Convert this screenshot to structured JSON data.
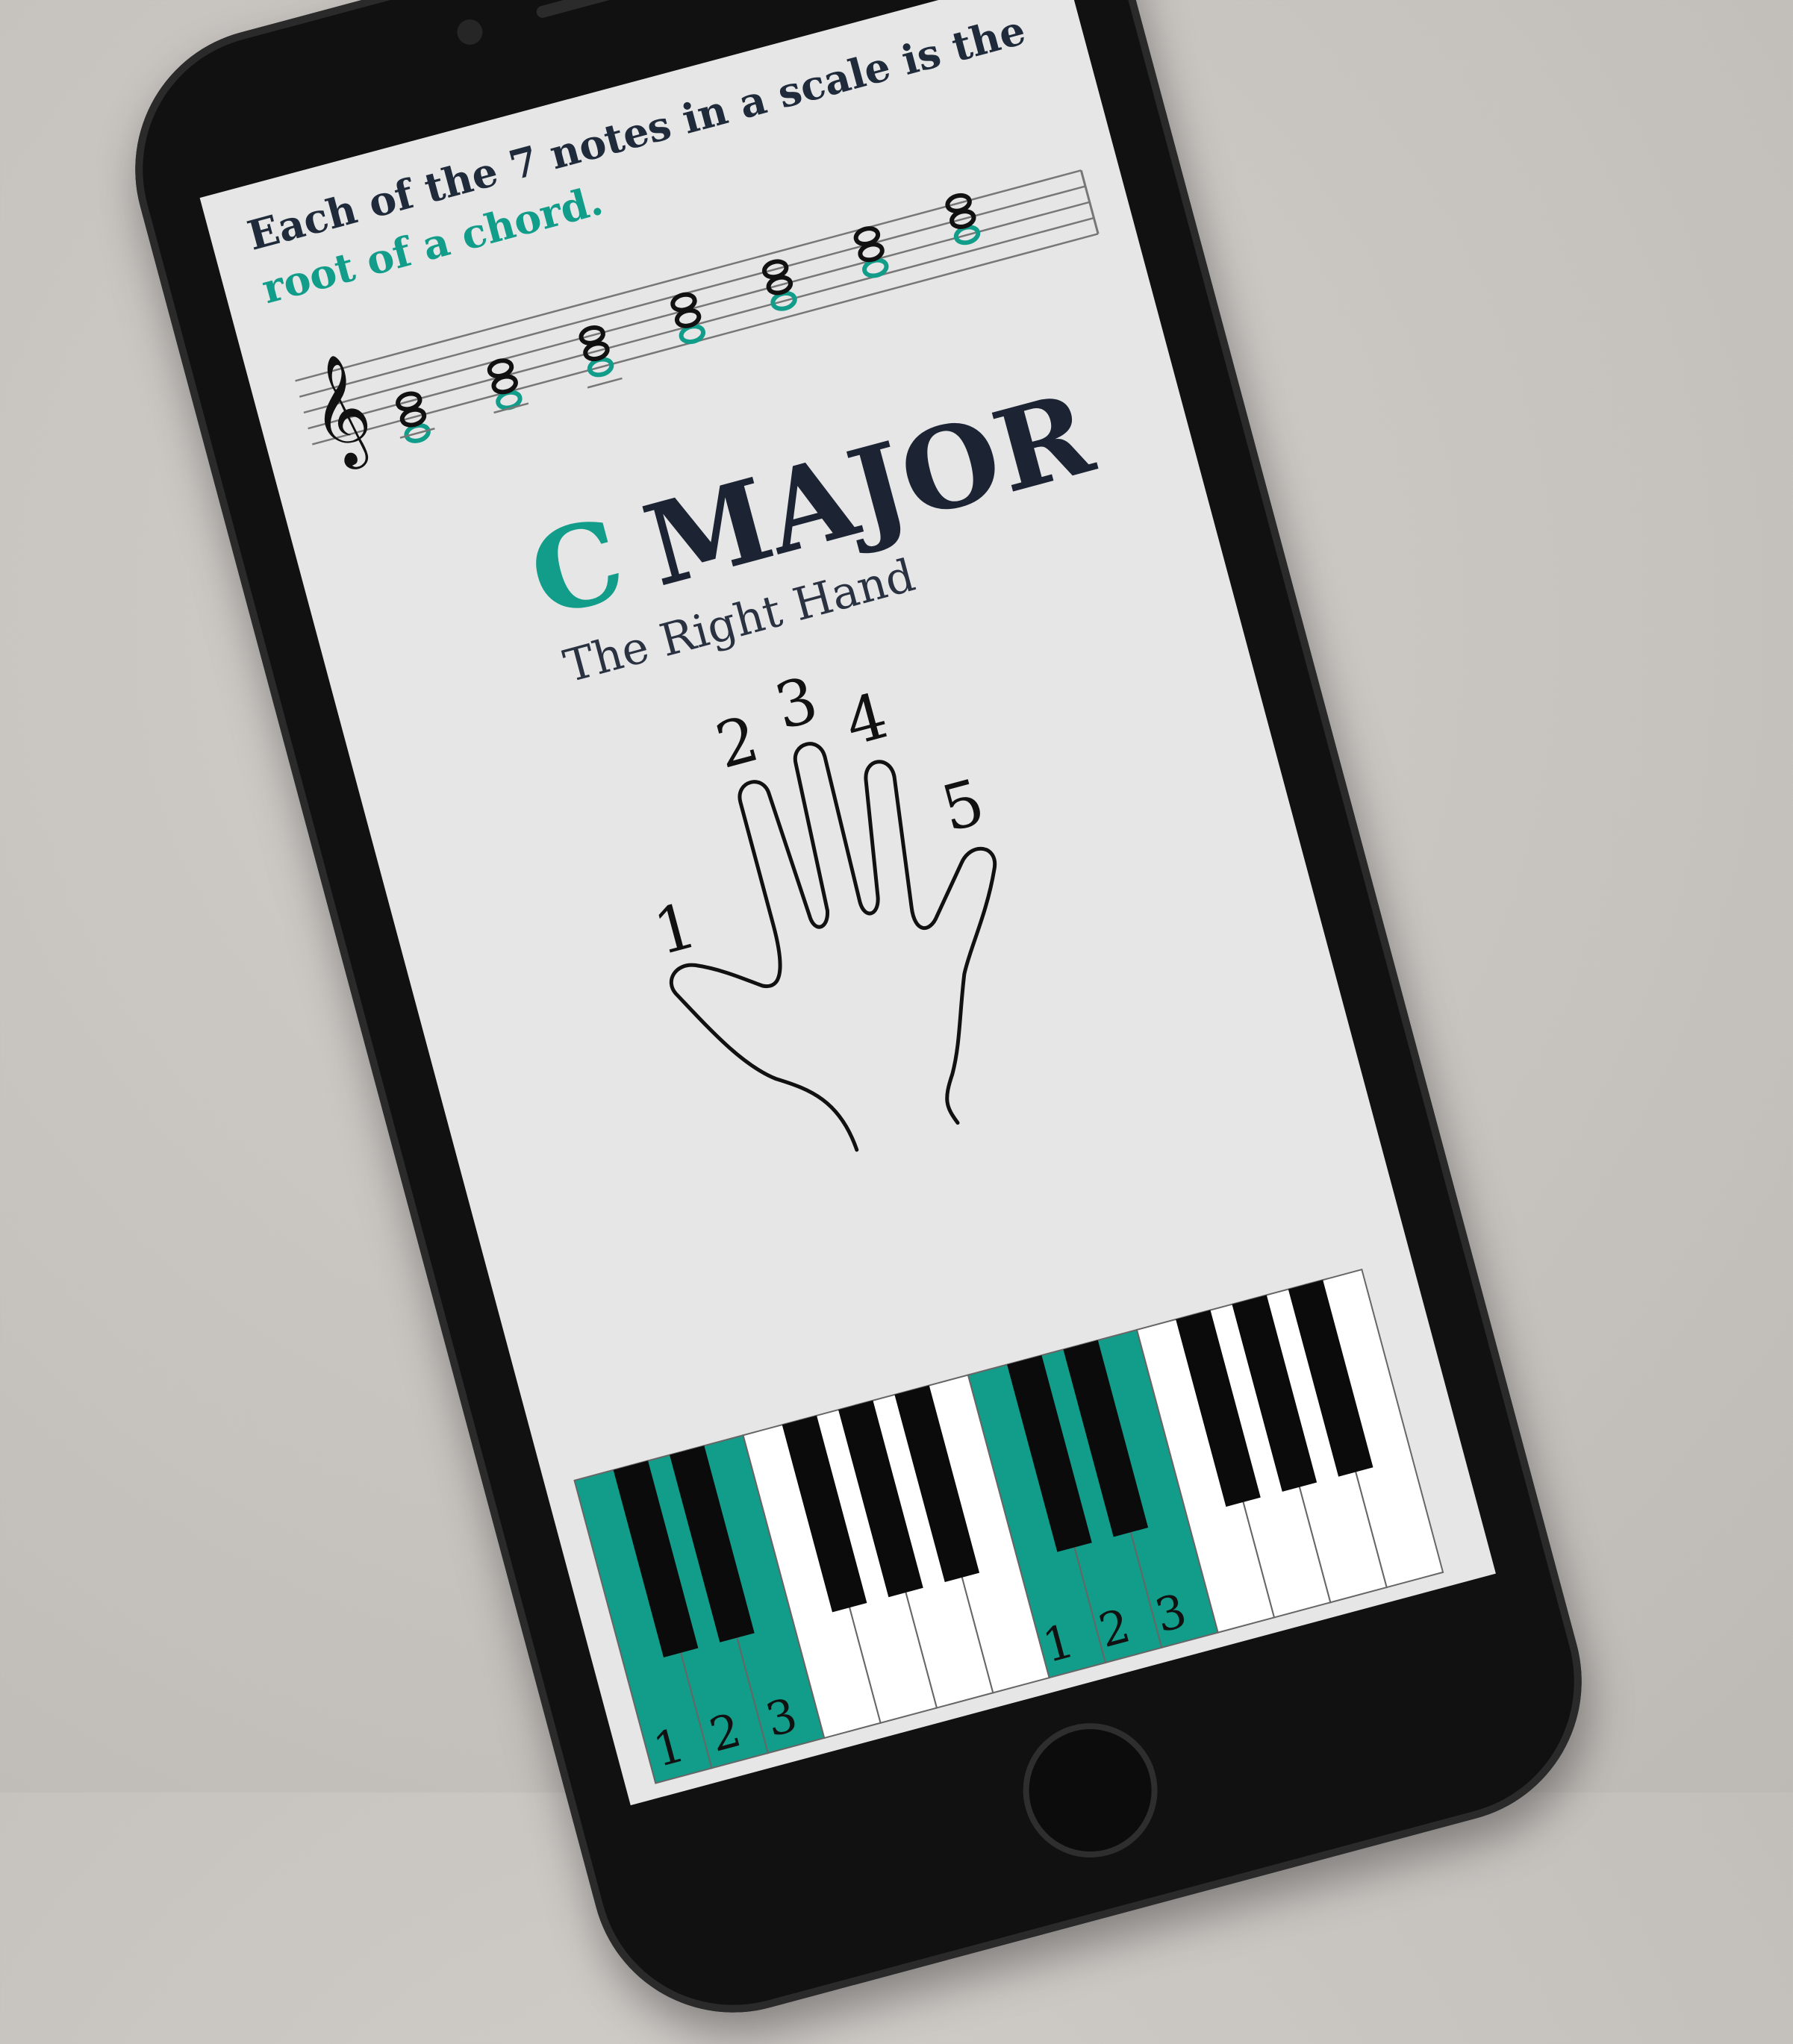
{
  "intro": {
    "line1": "Each of the 7 notes in a scale is the",
    "line2": "root of a chord."
  },
  "title": {
    "root": "C",
    "quality": "MAJOR",
    "subtitle": "The Right Hand"
  },
  "fingers": [
    "1",
    "2",
    "3",
    "4",
    "5"
  ],
  "keyboard": {
    "fingering_left": [
      "1",
      "2",
      "3"
    ],
    "fingering_right": [
      "1",
      "2",
      "3"
    ],
    "highlight_color": "#119d8a"
  },
  "colors": {
    "accent": "#119d8a",
    "text": "#1c2434"
  }
}
